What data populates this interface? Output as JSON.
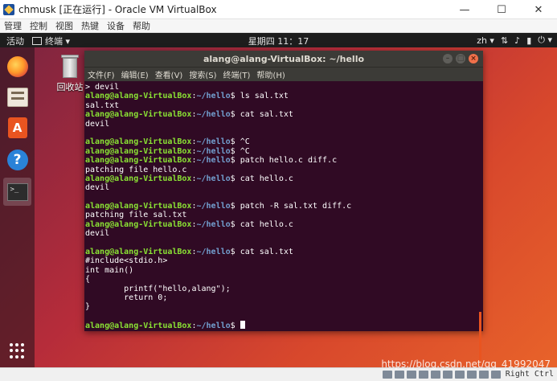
{
  "host_window": {
    "title": "chmusk [正在运行] - Oracle VM VirtualBox",
    "icon": "virtualbox-icon",
    "controls": {
      "minimize": "—",
      "maximize": "☐",
      "close": "✕"
    },
    "menu": [
      "管理",
      "控制",
      "视图",
      "热键",
      "设备",
      "帮助"
    ]
  },
  "topbar": {
    "activities": "活动",
    "app_label": "终端 ▾",
    "clock": "星期四 11：17",
    "lang": "zh ▾",
    "indicators": [
      "network-icon",
      "volume-icon",
      "battery-icon",
      "power-icon"
    ],
    "indicator_glyphs": [
      "⇅",
      "♪",
      "▮",
      "⏻ ▾"
    ]
  },
  "dock": {
    "items": [
      {
        "name": "firefox",
        "icon": "firefox-icon"
      },
      {
        "name": "files",
        "icon": "files-icon"
      },
      {
        "name": "software",
        "icon": "software-store-icon",
        "glyph": "A"
      },
      {
        "name": "help",
        "icon": "help-icon",
        "glyph": "?"
      },
      {
        "name": "terminal",
        "icon": "terminal-icon",
        "glyph": ">_",
        "active": true
      }
    ],
    "show_apps_icon": "show-applications-icon"
  },
  "desktop": {
    "trash_label": "回收站"
  },
  "terminal": {
    "title": "alang@alang-VirtualBox: ~/hello",
    "menu": [
      "文件(F)",
      "编辑(E)",
      "查看(V)",
      "搜索(S)",
      "终端(T)",
      "帮助(H)"
    ],
    "prompt_user": "alang@alang-VirtualBox",
    "prompt_path": "~/hello",
    "lines": [
      {
        "kind": "out",
        "text": "> devil"
      },
      {
        "kind": "cmd",
        "text": "ls sal.txt"
      },
      {
        "kind": "out",
        "text": "sal.txt"
      },
      {
        "kind": "cmd",
        "text": "cat sal.txt"
      },
      {
        "kind": "out",
        "text": "devil"
      },
      {
        "kind": "out",
        "text": ""
      },
      {
        "kind": "cmd",
        "text": "^C"
      },
      {
        "kind": "cmd",
        "text": "^C"
      },
      {
        "kind": "cmd",
        "text": "patch hello.c diff.c"
      },
      {
        "kind": "out",
        "text": "patching file hello.c"
      },
      {
        "kind": "cmd",
        "text": "cat hello.c"
      },
      {
        "kind": "out",
        "text": "devil"
      },
      {
        "kind": "out",
        "text": ""
      },
      {
        "kind": "cmd",
        "text": "patch -R sal.txt diff.c"
      },
      {
        "kind": "out",
        "text": "patching file sal.txt"
      },
      {
        "kind": "cmd",
        "text": "cat hello.c"
      },
      {
        "kind": "out",
        "text": "devil"
      },
      {
        "kind": "out",
        "text": ""
      },
      {
        "kind": "cmd",
        "text": "cat sal.txt"
      },
      {
        "kind": "out",
        "text": "#include<stdio.h>"
      },
      {
        "kind": "out",
        "text": "int main()"
      },
      {
        "kind": "out",
        "text": "{"
      },
      {
        "kind": "out",
        "text": "        printf(\"hello,alang\");"
      },
      {
        "kind": "out",
        "text": "        return 0;"
      },
      {
        "kind": "out",
        "text": "}"
      },
      {
        "kind": "out",
        "text": ""
      },
      {
        "kind": "cmd",
        "text": "",
        "cursor": true
      }
    ]
  },
  "statusbar": {
    "watermark": "https://blog.csdn.net/qq_41992047",
    "host_key": "Right Ctrl"
  },
  "colors": {
    "terminal_bg": "#300a24",
    "prompt_user": "#8ae234",
    "prompt_path": "#729fcf",
    "ubuntu_orange": "#e95420"
  }
}
